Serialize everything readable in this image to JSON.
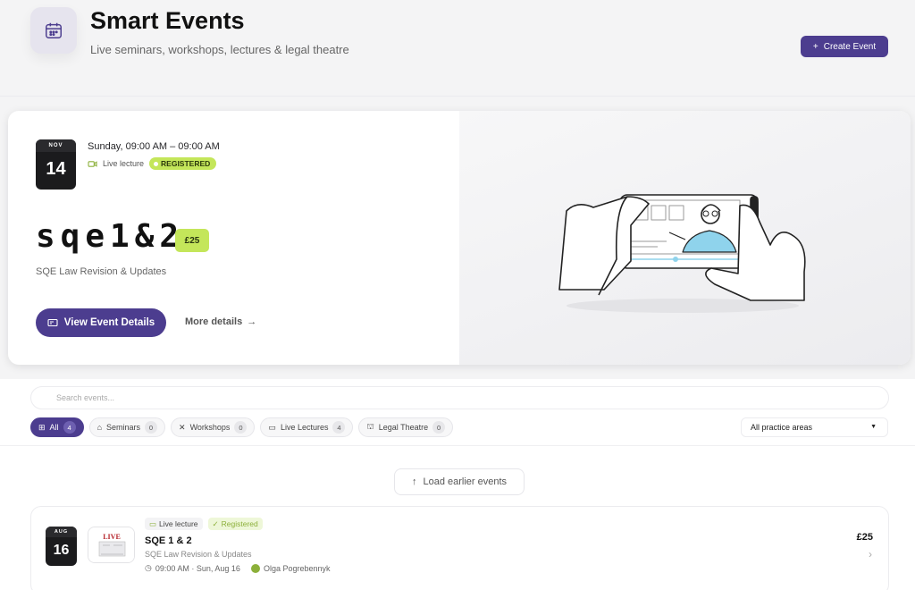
{
  "header": {
    "title": "Smart Events",
    "subtitle": "Live seminars, workshops, lectures & legal theatre",
    "create_label": "Create Event"
  },
  "hero": {
    "month": "NOV",
    "day": "14",
    "when": "Sunday, 09:00 AM – 09:00 AM",
    "type": "Live lecture",
    "status": "REGISTERED",
    "title": "sqe1&2",
    "price": "£25",
    "subtitle": "SQE Law Revision & Updates",
    "view_label": "View Event Details",
    "more_label": "More details"
  },
  "search": {
    "placeholder": "Search events..."
  },
  "filters": [
    {
      "label": "All",
      "count": "4"
    },
    {
      "label": "Seminars",
      "count": "0"
    },
    {
      "label": "Workshops",
      "count": "0"
    },
    {
      "label": "Live Lectures",
      "count": "4"
    },
    {
      "label": "Legal Theatre",
      "count": "0"
    }
  ],
  "practice_area": "All practice areas",
  "load_label": "Load earlier events",
  "event": {
    "month": "AUG",
    "day": "16",
    "type": "Live lecture",
    "status": "Registered",
    "title": "SQE 1 & 2",
    "subtitle": "SQE Law Revision & Updates",
    "time": "09:00 AM · Sun, Aug 16",
    "host": "Olga Pogrebennyk",
    "price": "£25",
    "thumb_text": "LIVE"
  },
  "colors": {
    "accent": "#4c3d8f",
    "lime": "#c4e65a"
  }
}
